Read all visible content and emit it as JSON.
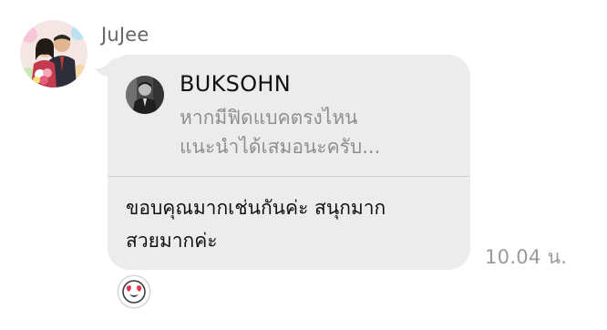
{
  "message": {
    "sender_name": "JuJee",
    "reply": {
      "author": "BUKSOHN",
      "quote_line1": "หากมีฟิดแบคตรงไหน",
      "quote_line2": "แนะนำได้เสมอนะครับ..."
    },
    "text_line1": "ขอบคุณมากเช่นกันค่ะ สนุกมาก",
    "text_line2": "สวยมากค่ะ",
    "timestamp": "10.04 น.",
    "reaction": "heart-eyes-emoji-icon"
  },
  "colors": {
    "bubble": "#ececec",
    "sender_name": "#666666",
    "quote_text": "#8e8e8e",
    "timestamp": "#9a9a9a",
    "divider": "#d2d2d2"
  }
}
